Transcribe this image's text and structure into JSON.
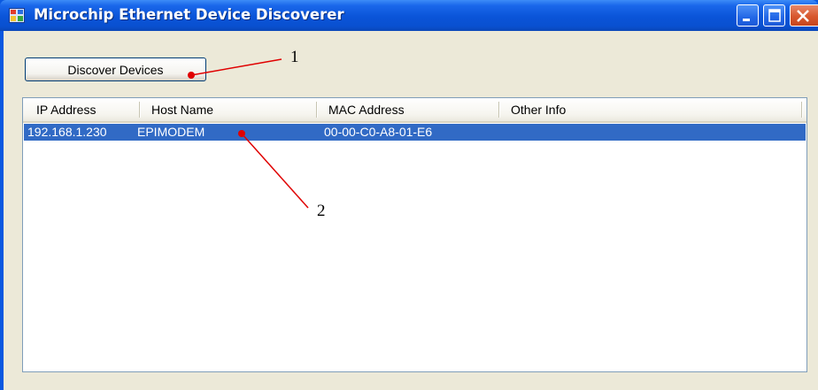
{
  "window": {
    "title": "Microchip Ethernet Device Discoverer",
    "controls": [
      "minimize-icon",
      "maximize-icon",
      "close-icon"
    ]
  },
  "toolbar": {
    "discover_label": "Discover Devices"
  },
  "table": {
    "columns": [
      "IP Address",
      "Host Name",
      "MAC Address",
      "Other Info"
    ],
    "rows": [
      {
        "ip": "192.168.1.230",
        "host": "EPIMODEM",
        "mac": "00-00-C0-A8-01-E6",
        "other": "",
        "selected": true
      }
    ]
  },
  "annotations": {
    "callout_1": "1",
    "callout_2": "2"
  },
  "colors": {
    "titlebar": "#0a54d8",
    "selection": "#316ac5",
    "annotation_line": "#e00000",
    "client_bg": "#ece9d8"
  }
}
